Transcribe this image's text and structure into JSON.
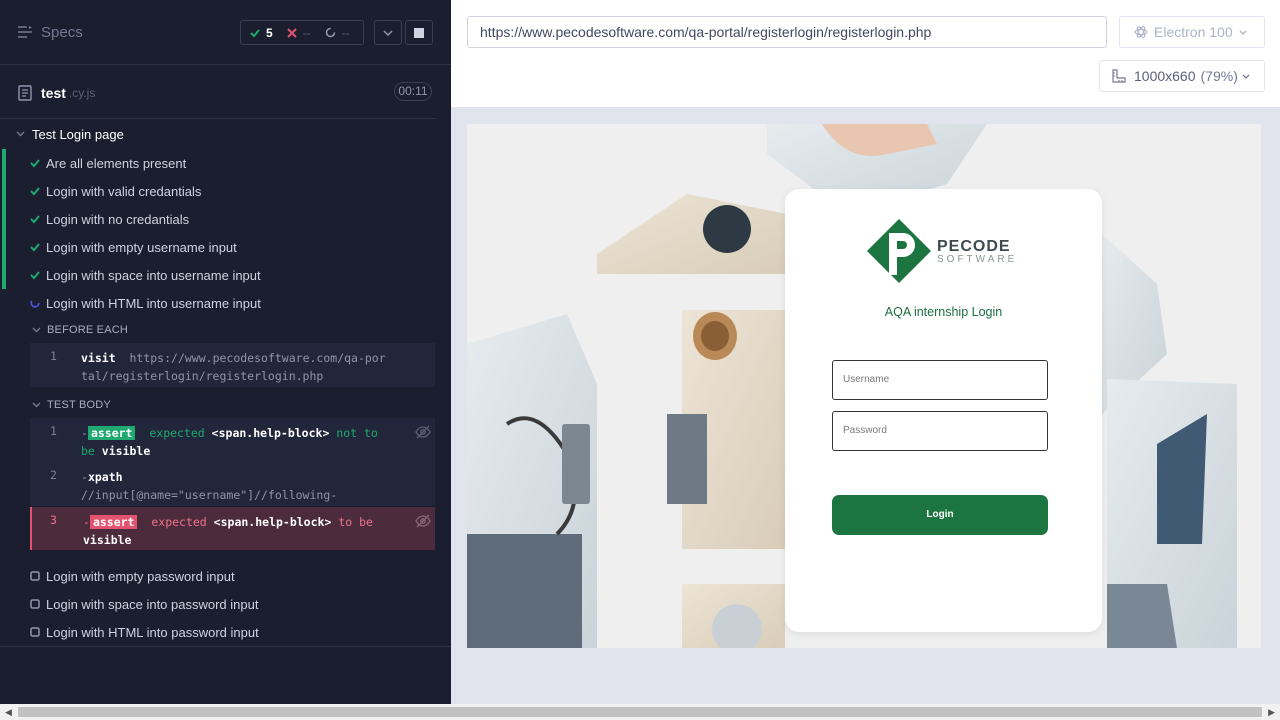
{
  "reporter": {
    "specs_label": "Specs",
    "stats": {
      "passed": "5",
      "failed": "--",
      "pending": "--"
    },
    "file": {
      "name": "test",
      "ext": ".cy.js",
      "duration": "00:11"
    },
    "suite": "Test Login page",
    "tests": [
      {
        "label": "Are all elements present",
        "state": "passed"
      },
      {
        "label": "Login with valid credantials",
        "state": "passed"
      },
      {
        "label": "Login with no credantials",
        "state": "passed"
      },
      {
        "label": "Login with empty username input",
        "state": "passed"
      },
      {
        "label": "Login with space into username input",
        "state": "passed"
      },
      {
        "label": "Login with HTML into username input",
        "state": "running"
      }
    ],
    "before_each": {
      "header": "BEFORE EACH",
      "cmd": {
        "num": "1",
        "name": "visit",
        "arg": "https://www.pecodesoftware.com/qa-portal/registerlogin/registerlogin.php"
      }
    },
    "test_body": {
      "header": "TEST BODY",
      "cmds": [
        {
          "num": "1",
          "dash": "-",
          "name": "assert",
          "expected": "expected",
          "el": "<span.help-block>",
          "msg": "not to be",
          "end": "visible"
        },
        {
          "num": "2",
          "dash": "-",
          "name": "xpath",
          "arg": "//input[@name=\"username\"]//following-sibling::span"
        },
        {
          "num": "3",
          "dash": "-",
          "name": "assert",
          "expected": "expected",
          "el": "<span.help-block>",
          "msg": "to be",
          "end": "visible"
        }
      ]
    },
    "pending_tests": [
      "Login with empty password input",
      "Login with space into password input",
      "Login with HTML into password input"
    ]
  },
  "aut": {
    "url": "https://www.pecodesoftware.com/qa-portal/registerlogin/registerlogin.php",
    "browser": "Electron 100",
    "viewport": "1000x660",
    "scale": "(79%)",
    "page": {
      "logo_main": "PECODE",
      "logo_sub": "SOFTWARE",
      "title": "AQA internship Login",
      "username_placeholder": "Username",
      "password_placeholder": "Password",
      "login_button": "Login"
    }
  },
  "colors": {
    "passed": "#1fa971",
    "failed": "#e3526e",
    "brand": "#1c7440"
  }
}
